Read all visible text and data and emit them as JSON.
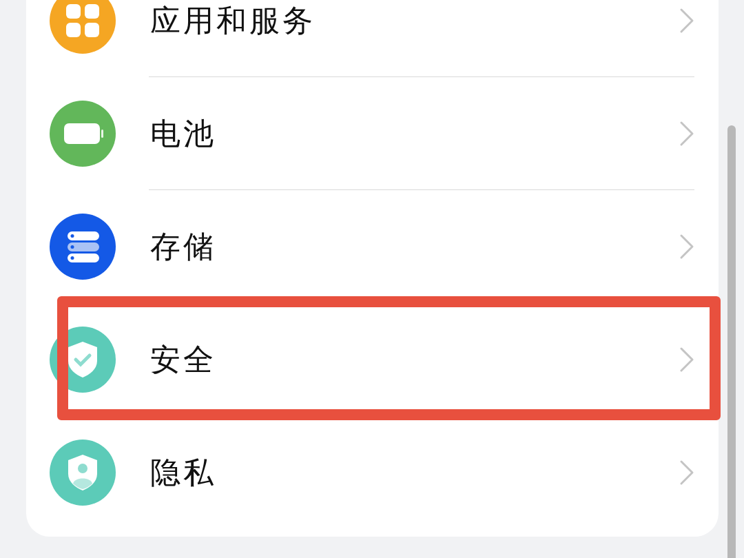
{
  "settings_list": [
    {
      "label": "应用和服务",
      "kind": "apps",
      "highlighted": false
    },
    {
      "label": "电池",
      "kind": "battery",
      "highlighted": false
    },
    {
      "label": "存储",
      "kind": "storage",
      "highlighted": false
    },
    {
      "label": "安全",
      "kind": "security",
      "highlighted": true
    },
    {
      "label": "隐私",
      "kind": "privacy",
      "highlighted": false
    }
  ]
}
